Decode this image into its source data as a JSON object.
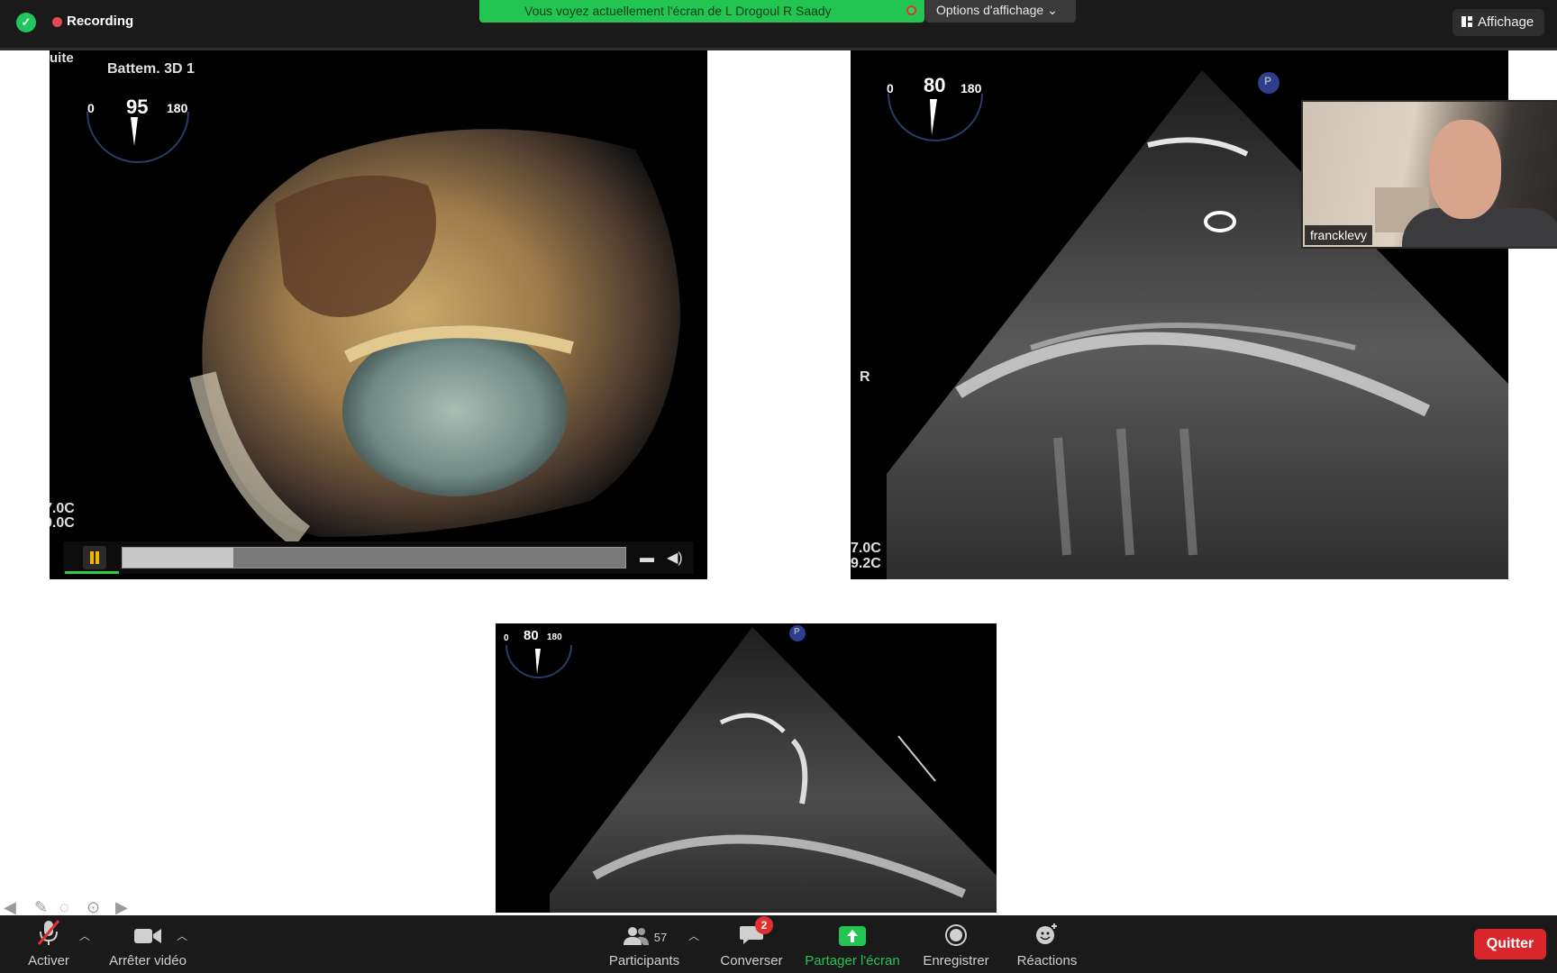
{
  "top_bar": {
    "recording_label": "Recording",
    "share_banner": "Vous voyez actuellement l'écran de L Drogoul R Saady",
    "view_options_label": "Options d'affichage",
    "view_button_label": "Affichage"
  },
  "panel_3d": {
    "corner_label": "uite",
    "title": "Battem. 3D 1",
    "dial": {
      "min": "0",
      "value": "95",
      "max": "180"
    },
    "temp_top": "7.0C",
    "temp_bottom": "9.0C",
    "playback_progress": 0.22
  },
  "panel_echo": {
    "dial": {
      "min": "0",
      "value": "80",
      "max": "180"
    },
    "marker_p": "P",
    "marker_r": "R",
    "temp_top": "7.0C",
    "temp_bottom": "9.2C"
  },
  "panel_echo2": {
    "dial": {
      "min": "0",
      "value": "80",
      "max": "180"
    },
    "marker_p": "P"
  },
  "self_view": {
    "name": "francklevy"
  },
  "toolbar": {
    "mute_label": "Activer",
    "video_label": "Arrêter vidéo",
    "participants_count": "57",
    "participants_label": "Participants",
    "chat_label": "Converser",
    "chat_badge": "2",
    "share_label": "Partager l'écran",
    "record_label": "Enregistrer",
    "reactions_label": "Réactions",
    "quit_label": "Quitter"
  },
  "colors": {
    "share_green": "#23c552",
    "quit_red": "#d8262c",
    "record_dot": "#e5484d"
  }
}
